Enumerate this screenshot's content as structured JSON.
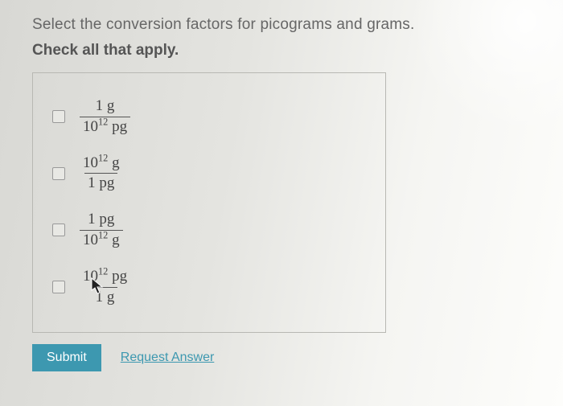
{
  "prompt": "Select the conversion factors for picograms and grams.",
  "instruction": "Check all that apply.",
  "options": [
    {
      "num_val": "1",
      "num_unit": "g",
      "num_exp": "",
      "den_val": "10",
      "den_exp": "12",
      "den_unit": "pg",
      "checked": false
    },
    {
      "num_val": "10",
      "num_unit": "g",
      "num_exp": "12",
      "den_val": "1",
      "den_exp": "",
      "den_unit": "pg",
      "checked": false
    },
    {
      "num_val": "1",
      "num_unit": "pg",
      "num_exp": "",
      "den_val": "10",
      "den_exp": "12",
      "den_unit": "g",
      "checked": false
    },
    {
      "num_val": "10",
      "num_unit": "pg",
      "num_exp": "12",
      "den_val": "1",
      "den_exp": "",
      "den_unit": "g",
      "checked": false
    }
  ],
  "actions": {
    "submit_label": "Submit",
    "request_label": "Request Answer"
  }
}
